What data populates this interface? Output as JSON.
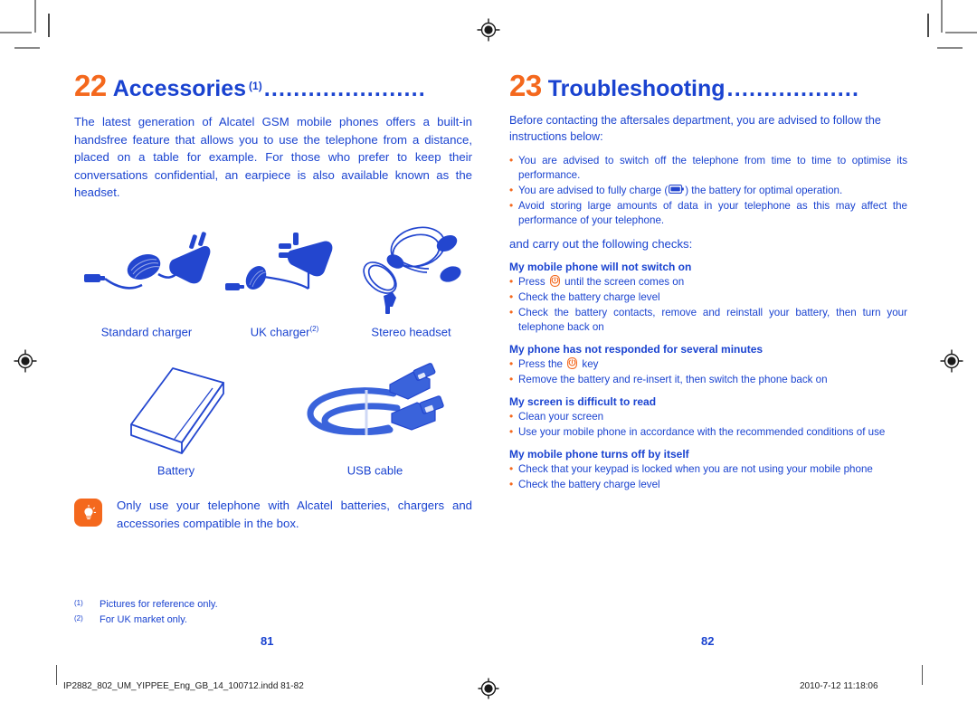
{
  "document": {
    "left_page_number": "81",
    "right_page_number": "82",
    "footer_filename": "IP2882_802_UM_YIPPEE_Eng_GB_14_100712.indd   81-82",
    "footer_timestamp": "2010-7-12   11:18:06"
  },
  "colors": {
    "brand_blue": "#1a43d0",
    "brand_orange": "#f4681d",
    "paper": "#ffffff"
  },
  "left_page": {
    "chapter": {
      "number": "22",
      "title": "Accessories",
      "superscript": "(1)",
      "dots": "......................"
    },
    "intro": "The latest generation of Alcatel GSM mobile phones offers a built-in handsfree feature that allows you to use the telephone from a distance, placed on a table for example. For those who prefer to keep their conversations confidential, an earpiece is also available known as the headset.",
    "accessories_row1": [
      {
        "icon": "standard-charger-illustration",
        "caption": "Standard charger",
        "superscript": ""
      },
      {
        "icon": "uk-charger-illustration",
        "caption": "UK charger",
        "superscript": "(2)"
      },
      {
        "icon": "stereo-headset-illustration",
        "caption": "Stereo headset",
        "superscript": ""
      }
    ],
    "accessories_row2": [
      {
        "icon": "battery-illustration",
        "caption": "Battery",
        "superscript": ""
      },
      {
        "icon": "usb-cable-illustration",
        "caption": "USB cable",
        "superscript": ""
      }
    ],
    "tip": {
      "icon": "lightbulb-tip-icon",
      "text": "Only use your telephone with Alcatel batteries, chargers and accessories compatible in the box."
    },
    "footnotes": [
      {
        "mark": "(1)",
        "text": "Pictures for reference only."
      },
      {
        "mark": "(2)",
        "text": "For UK market only."
      }
    ]
  },
  "right_page": {
    "chapter": {
      "number": "23",
      "title": "Troubleshooting",
      "superscript": "",
      "dots": ".................."
    },
    "intro": "Before contacting the aftersales department, you are advised to follow the instructions below:",
    "advice_bullets": [
      {
        "text_before": "You are advised to switch off the telephone from time to time to optimise its performance.",
        "icon": "",
        "text_after": "",
        "justify": true
      },
      {
        "text_before": "You are advised to fully charge (",
        "icon": "battery-icon",
        "text_after": ") the battery for optimal operation.",
        "justify": false
      },
      {
        "text_before": "Avoid storing large amounts of      data in your telephone as this may affect the performance of your telephone.",
        "icon": "",
        "text_after": "",
        "justify": true
      }
    ],
    "carry_out": "and carry out the following checks:",
    "sections": [
      {
        "heading": "My mobile phone will not switch on",
        "bullets": [
          {
            "text_before": "Press ",
            "icon": "power-key-icon",
            "text_after": " until the screen comes on",
            "justify": false
          },
          {
            "text_before": "Check the battery charge level",
            "icon": "",
            "text_after": "",
            "justify": false
          },
          {
            "text_before": "Check the battery contacts, remove and reinstall your battery, then turn your telephone back on",
            "icon": "",
            "text_after": "",
            "justify": true
          }
        ]
      },
      {
        "heading": "My phone has not responded for several minutes",
        "bullets": [
          {
            "text_before": "Press the ",
            "icon": "power-key-icon",
            "text_after": " key",
            "justify": false
          },
          {
            "text_before": "Remove the battery and re-insert it, then switch the phone back on",
            "icon": "",
            "text_after": "",
            "justify": false
          }
        ]
      },
      {
        "heading": "My screen is difficult to read",
        "bullets": [
          {
            "text_before": "Clean your screen",
            "icon": "",
            "text_after": "",
            "justify": false
          },
          {
            "text_before": "Use your mobile phone in accordance with the recommended conditions of use",
            "icon": "",
            "text_after": "",
            "justify": false
          }
        ]
      },
      {
        "heading": "My mobile phone turns off by itself",
        "bullets": [
          {
            "text_before": "Check that your keypad is locked when you are not using your mobile phone",
            "icon": "",
            "text_after": "",
            "justify": false
          },
          {
            "text_before": "Check the battery charge level",
            "icon": "",
            "text_after": "",
            "justify": false
          }
        ]
      }
    ]
  }
}
